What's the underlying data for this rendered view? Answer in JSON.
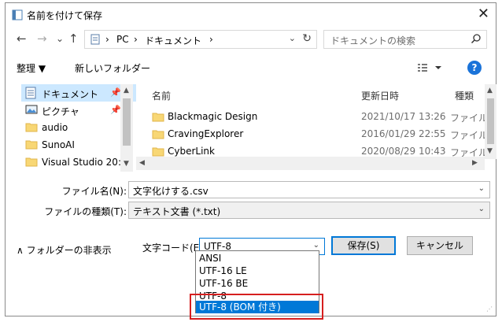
{
  "window": {
    "title": "名前を付けて保存",
    "close_glyph": "✕"
  },
  "nav": {
    "back": "←",
    "forward": "→",
    "recent": "⌄",
    "up": "↑",
    "breadcrumb": [
      "PC",
      "ドキュメント"
    ],
    "separator": "›",
    "search_placeholder": "ドキュメントの検索"
  },
  "toolbar": {
    "organize": "整理 ▼",
    "new_folder": "新しいフォルダー",
    "help": "?"
  },
  "sidebar": {
    "items": [
      {
        "label": "ドキュメント",
        "icon": "document-icon",
        "pinned": true,
        "selected": true
      },
      {
        "label": "ピクチャ",
        "icon": "picture-icon",
        "pinned": true,
        "selected": false
      },
      {
        "label": "audio",
        "icon": "folder-icon",
        "pinned": false,
        "selected": false
      },
      {
        "label": "SunoAI",
        "icon": "folder-icon",
        "pinned": false,
        "selected": false
      },
      {
        "label": "Visual Studio 20:",
        "icon": "folder-icon",
        "pinned": false,
        "selected": false
      }
    ]
  },
  "files": {
    "columns": [
      "名前",
      "更新日時",
      "種類"
    ],
    "rows": [
      {
        "name": "Blackmagic Design",
        "date": "2021/10/17 13:26",
        "type": "ファイル"
      },
      {
        "name": "CravingExplorer",
        "date": "2016/01/29 22:55",
        "type": "ファイル"
      },
      {
        "name": "CyberLink",
        "date": "2020/08/29 10:43",
        "type": "ファイル"
      }
    ]
  },
  "form": {
    "filename_label": "ファイル名(N):",
    "filename_value": "文字化けする.csv",
    "filetype_label": "ファイルの種類(T):",
    "filetype_value": "テキスト文書 (*.txt)",
    "hide_folders": "∧ フォルダーの非表示",
    "encoding_label": "文字コード(E):",
    "encoding_value": "UTF-8",
    "save_button": "保存(S)",
    "cancel_button": "キャンセル"
  },
  "encoding_options": [
    "ANSI",
    "UTF-16 LE",
    "UTF-16 BE",
    "UTF-8",
    "UTF-8 (BOM 付き)"
  ],
  "colors": {
    "accent": "#0078d7",
    "highlight_box": "#d61f1f",
    "selection": "#cce8ff",
    "folder": "#f8d775"
  }
}
